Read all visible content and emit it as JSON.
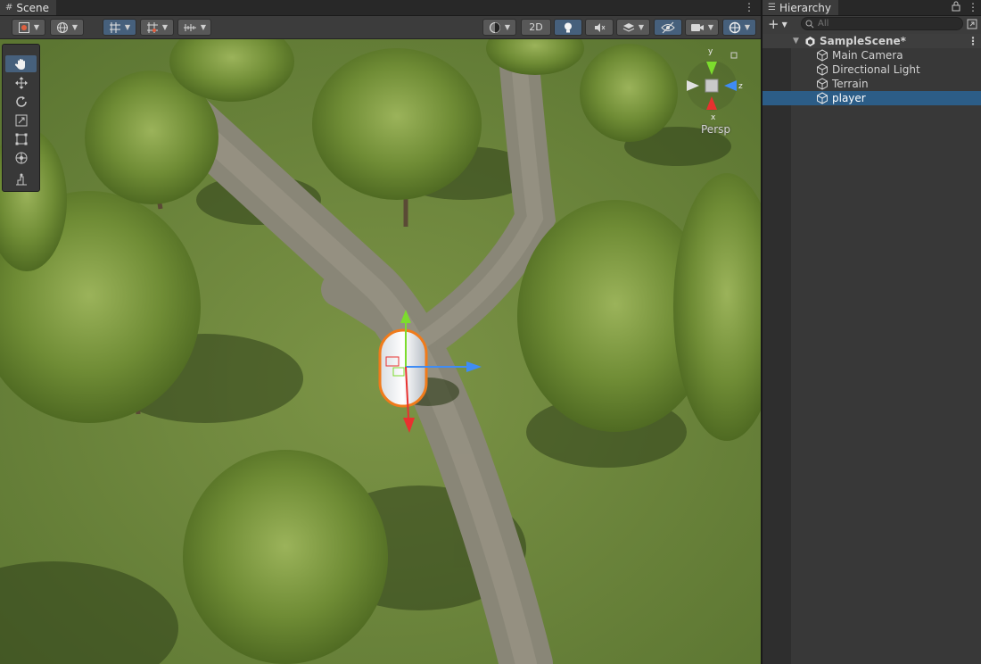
{
  "scene_panel": {
    "tab_label": "Scene",
    "tab_icon": "grid-icon",
    "toolbar": {
      "view_2d_label": "2D"
    },
    "gizmo": {
      "axis_y": "y",
      "axis_z": "z",
      "axis_x": "x",
      "projection_label": "Persp"
    },
    "tools": [
      "view-tool",
      "move-tool",
      "rotate-tool",
      "scale-tool",
      "rect-tool",
      "transform-tool",
      "custom-editor-tool"
    ],
    "active_tool": "view-tool"
  },
  "hierarchy_panel": {
    "tab_label": "Hierarchy",
    "tab_icon": "list-icon",
    "search_placeholder": "All",
    "scene_name": "SampleScene*",
    "items": [
      {
        "label": "Main Camera",
        "icon": "gameobject-cube-icon"
      },
      {
        "label": "Directional Light",
        "icon": "gameobject-cube-icon"
      },
      {
        "label": "Terrain",
        "icon": "gameobject-cube-icon"
      },
      {
        "label": "player",
        "icon": "gameobject-cube-icon",
        "selected": true
      }
    ]
  },
  "colors": {
    "selection": "#2c5d87",
    "toggle_on": "#46607c",
    "gizmo_x": "#e8312f",
    "gizmo_y": "#7cdc2d",
    "gizmo_z": "#3f8cf5",
    "selection_outline": "#f07b1b",
    "terrain_grass": "#6f8a3e",
    "terrain_path": "#858373"
  }
}
